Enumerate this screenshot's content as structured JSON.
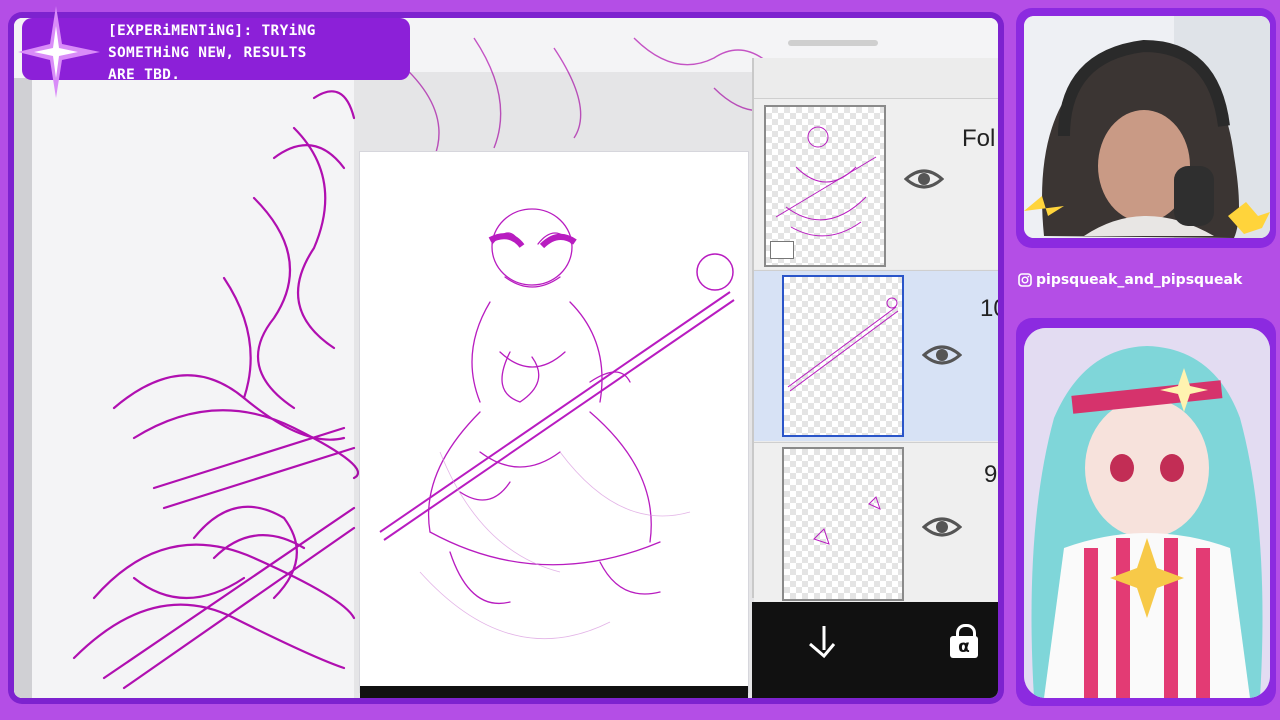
{
  "overlay": {
    "title_lines": [
      "[EXPERiMENTiNG]: TRYiNG",
      "SOMETHiNG NEW, RESULTS",
      "ARE TBD."
    ],
    "social_handle": "pipsqueak_and_pipsqueak",
    "social_icon": "instagram-icon"
  },
  "app": {
    "layers": [
      {
        "label": "Fol",
        "type": "folder",
        "visible": true,
        "selected": false
      },
      {
        "label": "10",
        "type": "layer",
        "visible": true,
        "selected": true
      },
      {
        "label": "9",
        "type": "layer",
        "visible": true,
        "selected": false
      }
    ],
    "toolbar": {
      "move_down_icon": "arrow-down-left-icon",
      "alpha_lock_icon": "alpha-lock-icon",
      "alpha_lock_label": "α"
    }
  },
  "colors": {
    "accent_purple": "#8c20d8",
    "sketch_magenta": "#b00fb0",
    "selected_layer": "#d7e2f5"
  }
}
